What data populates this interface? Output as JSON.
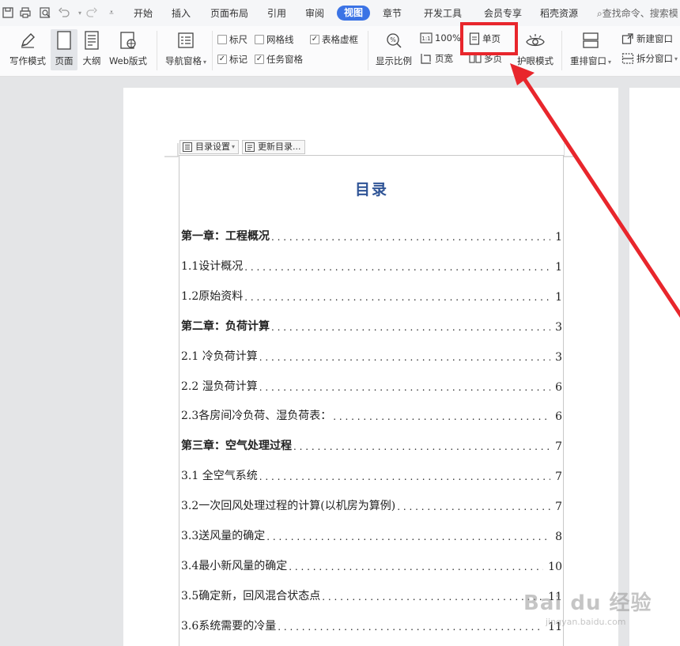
{
  "tabs": {
    "items": [
      "开始",
      "插入",
      "页面布局",
      "引用",
      "审阅",
      "视图",
      "章节",
      "开发工具",
      "会员专享",
      "稻壳资源"
    ],
    "active": "视图",
    "search_placeholder": "查找命令、搜索模"
  },
  "ribbon": {
    "write_mode": "写作模式",
    "page": "页面",
    "outline": "大纲",
    "web_layout": "Web版式",
    "nav_pane": "导航窗格",
    "ruler": "标尺",
    "gridlines": "网格线",
    "table_frame": "表格虚框",
    "markup": "标记",
    "task_pane": "任务窗格",
    "zoom": "显示比例",
    "percent": "100%",
    "page_width": "页宽",
    "single_page": "单页",
    "multi_page": "多页",
    "eye_mode": "护眼模式",
    "rearrange": "重排窗口",
    "new_window": "新建窗口",
    "split_window": "拆分窗口"
  },
  "toc": {
    "settings_btn": "目录设置",
    "update_btn": "更新目录...",
    "title": "目录",
    "entries": [
      {
        "text": "第一章：工程概况",
        "page": "1",
        "level": 1
      },
      {
        "text": "1.1设计概况",
        "page": "1",
        "level": 2
      },
      {
        "text": "1.2原始资料",
        "page": "1",
        "level": 2
      },
      {
        "text": "第二章：负荷计算",
        "page": "3",
        "level": 1
      },
      {
        "text": "2.1 冷负荷计算",
        "page": "3",
        "level": 2
      },
      {
        "text": "2.2 湿负荷计算",
        "page": "6",
        "level": 2
      },
      {
        "text": "2.3各房间冷负荷、湿负荷表：",
        "page": "6",
        "level": 2
      },
      {
        "text": "第三章：空气处理过程",
        "page": "7",
        "level": 1
      },
      {
        "text": "3.1 全空气系统",
        "page": "7",
        "level": 2
      },
      {
        "text": "3.2一次回风处理过程的计算(以机房为算例)",
        "page": "7",
        "level": 2
      },
      {
        "text": "3.3送风量的确定",
        "page": "8",
        "level": 2
      },
      {
        "text": "3.4最小新风量的确定",
        "page": "10",
        "level": 2
      },
      {
        "text": "3.5确定新，回风混合状态点",
        "page": "11",
        "level": 2
      },
      {
        "text": "3.6系统需要的冷量",
        "page": "11",
        "level": 2
      }
    ]
  },
  "watermark": {
    "brand": "Bai du 经验",
    "url": "jingyan.baidu.com"
  },
  "colors": {
    "active_tab": "#3b73e5",
    "highlight": "#e8262c",
    "toc_title": "#2f5496"
  }
}
